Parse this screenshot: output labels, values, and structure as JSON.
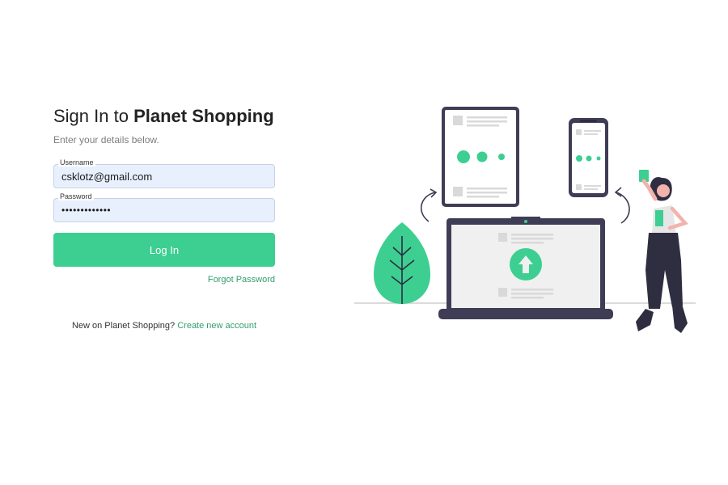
{
  "login": {
    "title_prefix": "Sign In to ",
    "title_brand": "Planet Shopping",
    "subtitle": "Enter your details below.",
    "username": {
      "label": "Username",
      "value": "csklotz@gmail.com"
    },
    "password": {
      "label": "Password",
      "value": "•••••••••••••"
    },
    "login_button": "Log In",
    "forgot_password": "Forgot Password",
    "signup_prompt": "New on Planet Shopping?",
    "signup_link": "Create new account"
  },
  "colors": {
    "accent": "#3ccf91",
    "link": "#2f9e6c",
    "input_fill": "#e8f0fe",
    "device_dark": "#3f3d56",
    "person_hair": "#2f2e41"
  },
  "illustration": {
    "icons": [
      "tablet-device-icon",
      "phone-device-icon",
      "laptop-device-icon",
      "upload-arrow-icon",
      "leaf-plant-icon",
      "person-figure-icon",
      "sync-arrow-icon"
    ]
  }
}
